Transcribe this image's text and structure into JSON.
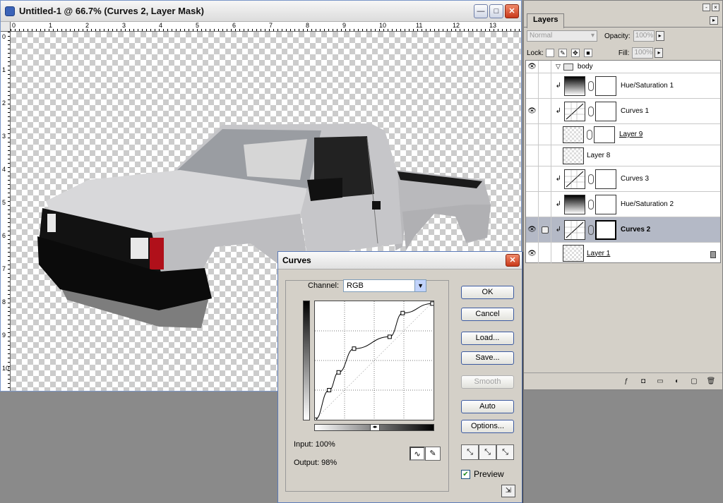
{
  "document": {
    "title": "Untitled-1 @ 66.7% (Curves 2, Layer Mask)",
    "window_buttons": {
      "minimize": "—",
      "maximize": "□",
      "close": "✕"
    },
    "ruler_top": [
      "0",
      "1",
      "2",
      "3",
      "4",
      "5",
      "6",
      "7",
      "8",
      "9",
      "10",
      "11",
      "12",
      "13"
    ],
    "ruler_left": [
      "0",
      "1",
      "2",
      "3",
      "4",
      "5",
      "6",
      "7",
      "8",
      "9",
      "10"
    ]
  },
  "layers_panel": {
    "tab": "Layers",
    "blend_mode": "Normal",
    "opacity_label": "Opacity:",
    "opacity_value": "100%",
    "lock_label": "Lock:",
    "fill_label": "Fill:",
    "fill_value": "100%",
    "group_name": "body",
    "layers": [
      {
        "name": "Hue/Saturation 1",
        "eye": false
      },
      {
        "name": "Curves 1",
        "eye": true
      },
      {
        "name": "Layer 9",
        "eye": false
      },
      {
        "name": "Layer 8",
        "eye": false
      },
      {
        "name": "Curves 3",
        "eye": false
      },
      {
        "name": "Hue/Saturation 2",
        "eye": false
      },
      {
        "name": "Curves 2",
        "eye": true,
        "selected": true
      },
      {
        "name": "Layer 1",
        "eye": true,
        "locked": true
      }
    ]
  },
  "curves": {
    "title": "Curves",
    "channel_label": "Channel:",
    "channel_value": "RGB",
    "input_label": "Input:",
    "input_value": "100%",
    "output_label": "Output:",
    "output_value": "98%",
    "buttons": {
      "ok": "OK",
      "cancel": "Cancel",
      "load": "Load...",
      "save": "Save...",
      "smooth": "Smooth",
      "auto": "Auto",
      "options": "Options..."
    },
    "preview_label": "Preview",
    "preview_checked": true,
    "curve_points_pct": [
      [
        0,
        0
      ],
      [
        12,
        25
      ],
      [
        20,
        40
      ],
      [
        33,
        60
      ],
      [
        63,
        70
      ],
      [
        74,
        90
      ],
      [
        99,
        98
      ]
    ]
  }
}
